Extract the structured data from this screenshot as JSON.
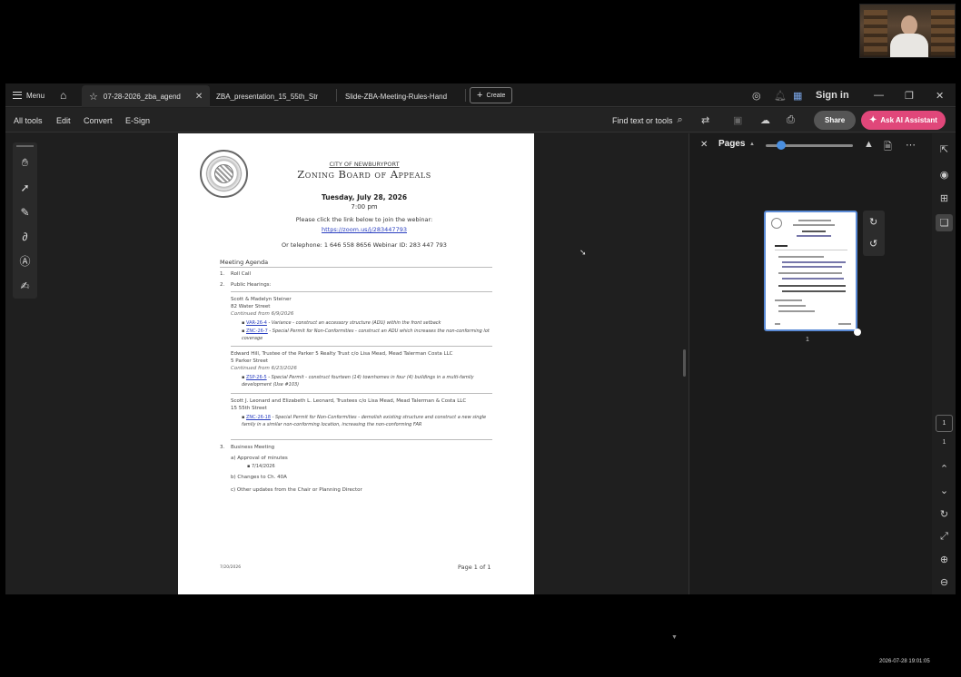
{
  "tabbar": {
    "menu_label": "Menu",
    "tabs": [
      {
        "label": "07-28-2026_zba_agend"
      },
      {
        "label": "ZBA_presentation_15_55th_Str"
      },
      {
        "label": "Slide-ZBA-Meeting-Rules-Hand"
      }
    ],
    "create_label": "Create",
    "sign_in": "Sign in"
  },
  "toolbar": {
    "all_tools": "All tools",
    "edit": "Edit",
    "convert": "Convert",
    "esign": "E-Sign",
    "find": "Find text or tools",
    "share": "Share",
    "ai_assistant": "Ask AI Assistant"
  },
  "document": {
    "city": "CITY OF NEWBURYPORT",
    "board": "Zoning Board of Appeals",
    "date": "Tuesday, July 28, 2026",
    "time": "7:00 pm",
    "please": "Please click the link below to join the webinar:",
    "link": "https://zoom.us/j/283447793",
    "phone": "Or telephone: 1 646 558 8656 Webinar ID: 283 447 793",
    "agenda_heading": "Meeting Agenda",
    "items": [
      {
        "num": "1.",
        "label": "Roll Call"
      },
      {
        "num": "2.",
        "label": "Public Hearings:"
      }
    ],
    "case1": {
      "name": "Scott & Madelyn Steiner",
      "street": "82 Water Street",
      "cont": "Continued from 6/9/2026",
      "b1_link": "VAR-26-4",
      "b1_text": " - Variance - construct an accessory structure (ADU) within the front setback",
      "b2_link": "ZNC-26-7",
      "b2_text": " - Special Permit for Non-Conformities - construct an ADU which increases the non-conforming lot coverage"
    },
    "case2": {
      "name": "Edward Hill, Trustee of the Parker 5 Realty Trust c/o Lisa Mead, Mead Talerman Costa LLC",
      "street": "5 Parker Street",
      "cont": "Continued from 6/23/2026",
      "b1_link": "ZSP-26-5",
      "b1_text": " - Special Permit - construct fourteen (14) townhomes in four (4) buildings in a multi-family development (Use #103)"
    },
    "case3": {
      "name": "Scott J. Leonard and Elizabeth L. Leonard, Trustees c/o Lisa Mead, Mead Talerman & Costa LLC",
      "street": "15 55th Street",
      "b1_link": "ZNC-26-18",
      "b1_text": " - Special Permit for Non-Conformities - demolish existing structure and construct a new single family in a similar non-conforming location, increasing the non-conforming FAR"
    },
    "business": {
      "num": "3.",
      "label": "Business Meeting"
    },
    "sub_a": "a)   Approval of minutes",
    "sub_a_bullet": "7/14/2026",
    "sub_b": "b)   Changes to Ch. 40A",
    "sub_c": "c)   Other updates from the Chair or Planning Director",
    "footer_date": "7/20/2026",
    "footer_page": "Page  1  of  1"
  },
  "panel": {
    "title": "Pages",
    "thumb_page": "1"
  },
  "nav": {
    "current_page": "1",
    "total_pages": "1"
  },
  "clock": "2026-07-28  19:01:05",
  "colors": {
    "ai_button": "#e0477a",
    "accent_blue": "#4a8fe0",
    "link_blue": "#2a3fc0"
  }
}
